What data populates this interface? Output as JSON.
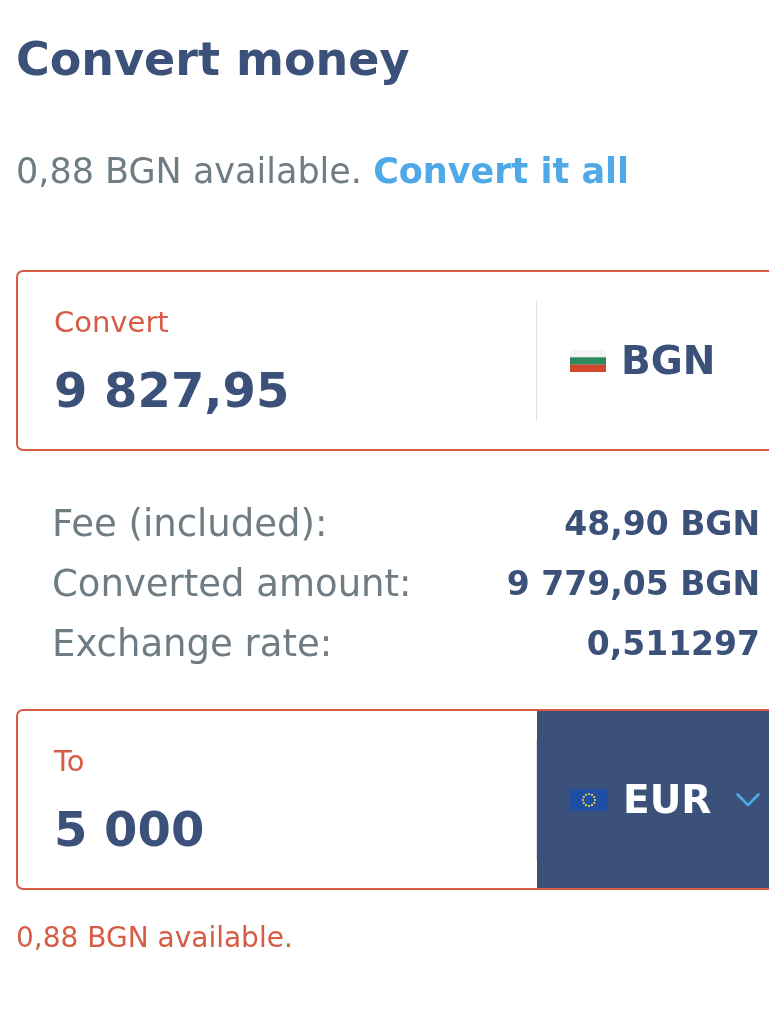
{
  "title": "Convert money",
  "balance": {
    "text": "0,88 BGN available.",
    "link": "Convert it all"
  },
  "from": {
    "label": "Convert",
    "value": "9 827,95",
    "error": true,
    "currency": {
      "code": "BGN",
      "kind": "bg",
      "highlighted": false,
      "dropdown": false
    }
  },
  "details": [
    {
      "label": "Fee (included):",
      "value": "48,90 BGN"
    },
    {
      "label": "Converted amount:",
      "value": "9 779,05 BGN"
    },
    {
      "label": "Exchange rate:",
      "value": "0,511297"
    }
  ],
  "to": {
    "label": "To",
    "value": "5 000",
    "error": true,
    "currency": {
      "code": "EUR",
      "kind": "eu",
      "highlighted": true,
      "dropdown": true
    }
  },
  "error_message": "0,88 BGN available."
}
